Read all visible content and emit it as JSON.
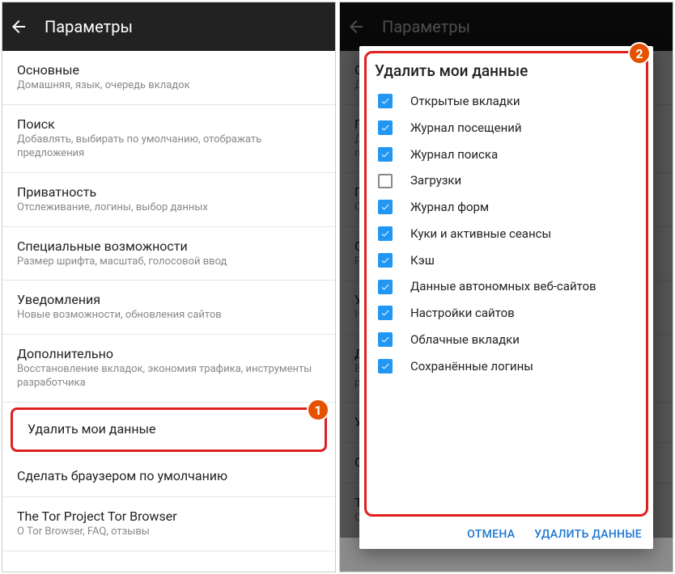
{
  "header": {
    "title": "Параметры"
  },
  "settings": [
    {
      "title": "Основные",
      "sub": "Домашняя, язык, очередь вкладок"
    },
    {
      "title": "Поиск",
      "sub": "Добавлять, выбирать по умолчанию, отображать предложения"
    },
    {
      "title": "Приватность",
      "sub": "Отслеживание, логины, выбор данных"
    },
    {
      "title": "Специальные возможности",
      "sub": "Размер шрифта, масштаб, голосовой ввод"
    },
    {
      "title": "Уведомления",
      "sub": "Новые возможности, обновления сайтов"
    },
    {
      "title": "Дополнительно",
      "sub": "Восстановление вкладок, экономия трафика, инструменты разработчика"
    },
    {
      "title": "Удалить мои данные",
      "sub": ""
    },
    {
      "title": "Сделать браузером по умолчанию",
      "sub": ""
    },
    {
      "title": "The Tor Project Tor Browser",
      "sub": "О Tor Browser, FAQ, отзывы"
    }
  ],
  "badges": {
    "one": "1",
    "two": "2"
  },
  "dialog": {
    "title": "Удалить мои данные",
    "items": [
      {
        "label": "Открытые вкладки",
        "checked": true
      },
      {
        "label": "Журнал посещений",
        "checked": true
      },
      {
        "label": "Журнал поиска",
        "checked": true
      },
      {
        "label": "Загрузки",
        "checked": false
      },
      {
        "label": "Журнал форм",
        "checked": true
      },
      {
        "label": "Куки и активные сеансы",
        "checked": true
      },
      {
        "label": "Кэш",
        "checked": true
      },
      {
        "label": "Данные автономных веб-сайтов",
        "checked": true
      },
      {
        "label": "Настройки сайтов",
        "checked": true
      },
      {
        "label": "Облачные вкладки",
        "checked": true
      },
      {
        "label": "Сохранённые логины",
        "checked": true
      }
    ],
    "cancel": "ОТМЕНА",
    "confirm": "УДАЛИТЬ ДАННЫЕ"
  }
}
